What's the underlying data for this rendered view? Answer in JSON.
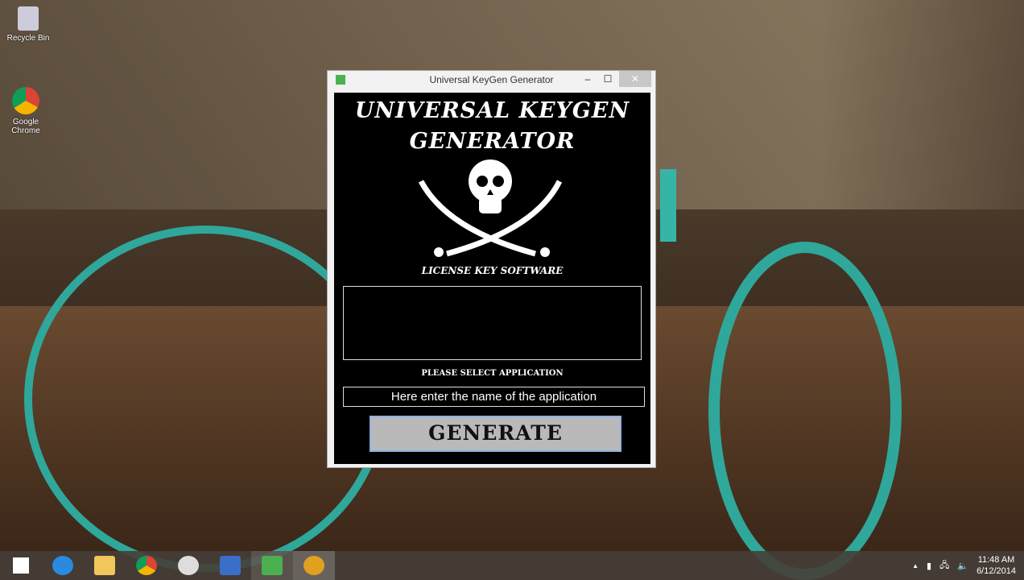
{
  "desktop": {
    "icons": [
      {
        "label": "Recycle Bin"
      },
      {
        "label": "Google Chrome"
      }
    ]
  },
  "window": {
    "title": "Universal KeyGen Generator",
    "heading_line1": "UNIVERSAL KEYGEN",
    "heading_line2": "GENERATOR",
    "subtitle": "LICENSE KEY SOFTWARE",
    "output_value": "",
    "select_label": "PLEASE SELECT APPLICATION",
    "app_input_value": "Here enter the name of the application",
    "generate_label": "GENERATE",
    "controls": {
      "minimize": "–",
      "maximize": "☐",
      "close": "✕"
    }
  },
  "taskbar": {
    "apps": [
      "start",
      "internet-explorer",
      "file-explorer",
      "chrome",
      "paint",
      "remote-desktop",
      "keygen",
      "globe-app"
    ],
    "time": "11:48 AM",
    "date": "6/12/2014",
    "tray_arrow": "▲"
  }
}
